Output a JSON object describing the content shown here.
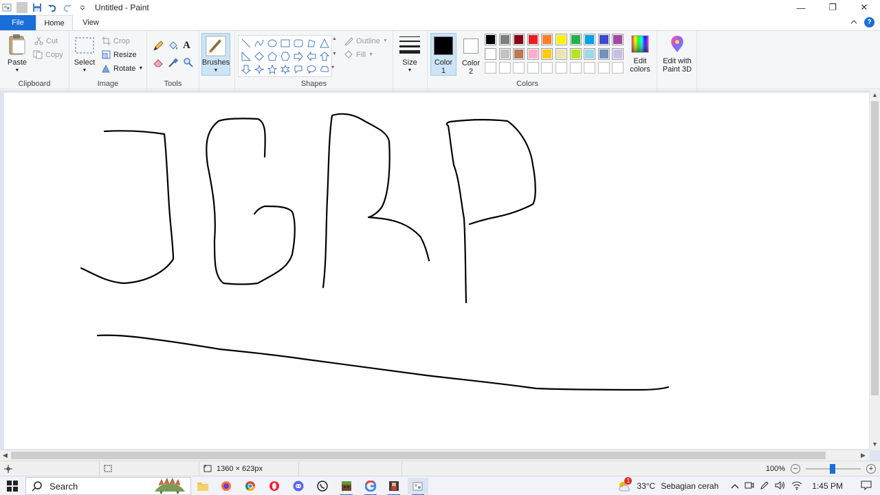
{
  "window": {
    "title": "Untitled - Paint"
  },
  "tabs": {
    "file": "File",
    "home": "Home",
    "view": "View"
  },
  "ribbon": {
    "clipboard": {
      "label": "Clipboard",
      "paste": "Paste",
      "cut": "Cut",
      "copy": "Copy"
    },
    "image": {
      "label": "Image",
      "select": "Select",
      "crop": "Crop",
      "resize": "Resize",
      "rotate": "Rotate"
    },
    "tools": {
      "label": "Tools"
    },
    "brushes": {
      "label": "Brushes"
    },
    "shapes": {
      "label": "Shapes",
      "outline": "Outline",
      "fill": "Fill"
    },
    "size": {
      "label": "Size"
    },
    "colors": {
      "label": "Colors",
      "color1_line1": "Color",
      "color1_line2": "1",
      "color2_line1": "Color",
      "color2_line2": "2",
      "edit_colors_line1": "Edit",
      "edit_colors_line2": "colors",
      "paint3d_line1": "Edit with",
      "paint3d_line2": "Paint 3D",
      "color1": "#000000",
      "color2": "#ffffff",
      "palette_row1": [
        "#000000",
        "#7f7f7f",
        "#880015",
        "#ed1c24",
        "#ff7f27",
        "#fff200",
        "#22b14c",
        "#00a2e8",
        "#3f48cc",
        "#a349a4"
      ],
      "palette_row2": [
        "#ffffff",
        "#c3c3c3",
        "#b97a57",
        "#ffaec9",
        "#ffc90e",
        "#efe4b0",
        "#b5e61d",
        "#99d9ea",
        "#7092be",
        "#c8bfe7"
      ],
      "palette_row3": [
        "#ffffff",
        "#ffffff",
        "#ffffff",
        "#ffffff",
        "#ffffff",
        "#ffffff",
        "#ffffff",
        "#ffffff",
        "#ffffff",
        "#ffffff"
      ]
    }
  },
  "status": {
    "dimensions": "1360 × 623px",
    "zoom": "100%"
  },
  "taskbar": {
    "search_placeholder": "Search",
    "weather_temp": "33°C",
    "weather_desc": "Sebagian cerah",
    "time": "1:45 PM",
    "weather_badge": "1"
  }
}
